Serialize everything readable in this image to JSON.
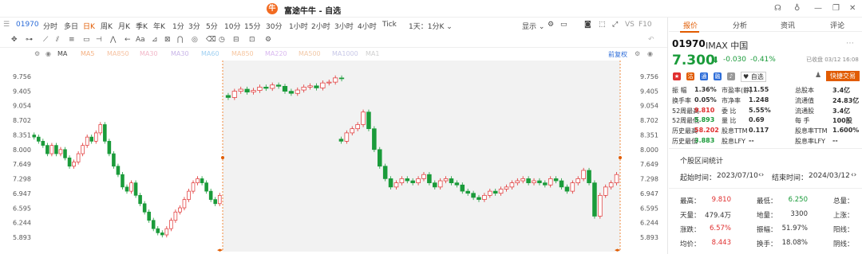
{
  "window": {
    "title": "富途牛牛 - 自选",
    "logo": "牛"
  },
  "toolbar": {
    "code": "01970",
    "periods": [
      "分时",
      "多日",
      "日K",
      "周K",
      "月K",
      "季K",
      "年K",
      "1分",
      "3分",
      "5分",
      "10分",
      "15分",
      "30分",
      "1小时",
      "2小时",
      "3小时",
      "4小时",
      "Tick"
    ],
    "active_period": "日K",
    "range": "1天：1分K ⌄",
    "display": "显示 ⌄",
    "vs": "VS",
    "f10": "F10"
  },
  "ma_row": {
    "label": "MA",
    "items": [
      "MA5",
      "MA850",
      "MA30",
      "MA30",
      "MA60",
      "MA850",
      "MA220",
      "MA500",
      "MA1000",
      "MA1"
    ],
    "restore": "前复权"
  },
  "chart_data": {
    "type": "candlestick",
    "y_ticks": [
      "9.756",
      "9.405",
      "9.054",
      "8.702",
      "8.351",
      "8.000",
      "7.649",
      "7.298",
      "6.947",
      "6.595",
      "6.244",
      "5.893"
    ],
    "y_range": [
      5.893,
      9.756
    ],
    "close": [
      8.3,
      8.2,
      8.1,
      7.9,
      8.1,
      7.9,
      8.0,
      7.8,
      7.6,
      7.7,
      7.9,
      8.1,
      8.3,
      8.2,
      8.4,
      8.6,
      8.2,
      7.9,
      7.6,
      7.4,
      7.1,
      7.0,
      7.2,
      6.9,
      6.7,
      6.5,
      6.3,
      6.1,
      6.0,
      5.95,
      6.1,
      6.3,
      6.5,
      6.6,
      6.8,
      7.0,
      7.2,
      7.3,
      7.2,
      7.0,
      6.8,
      6.7,
      6.9,
      9.25,
      9.4,
      9.45,
      9.38,
      9.42,
      9.5,
      9.47,
      9.55,
      9.52,
      9.4,
      9.35,
      9.43,
      9.5,
      9.53,
      9.48,
      9.6,
      9.62,
      9.72,
      9.7
    ],
    "close2": [
      8.2,
      8.4,
      8.5,
      8.6,
      8.9,
      8.5,
      8.0,
      7.6,
      7.3,
      7.1,
      7.2,
      7.3,
      7.25,
      7.2,
      7.3,
      7.4,
      7.2,
      7.1,
      7.25,
      7.3,
      7.2,
      7.15,
      7.0,
      6.95,
      6.85,
      6.8,
      6.9,
      7.0,
      6.95,
      7.05,
      7.1,
      7.2,
      7.25,
      7.3,
      7.2,
      7.25,
      7.2,
      7.15,
      7.3,
      7.25,
      7.1,
      7.0,
      7.2,
      7.3,
      7.5,
      7.2,
      6.4,
      6.9,
      7.1,
      7.2,
      7.4
    ]
  },
  "stock": {
    "code": "01970",
    "name": "IMAX 中国",
    "price": "7.300",
    "arrow": "⬇",
    "change": "-0.030",
    "pct": "-0.41%",
    "status": "已收盘 03/12 16:08",
    "quick_trade": "快捷交易",
    "self": "自选"
  },
  "rtabs": [
    "报价",
    "分析",
    "资讯",
    "评论"
  ],
  "info": [
    [
      "振    幅",
      "1.36%",
      "市盈率(静)",
      "11.55",
      "总股本",
      "3.4亿"
    ],
    [
      "换手率",
      "0.05%",
      "市净率",
      "1.248",
      "流通值",
      "24.83亿"
    ],
    [
      "52周最高",
      "9.810",
      "委    比",
      "5.55%",
      "流通股",
      "3.4亿"
    ],
    [
      "52周最低",
      "5.893",
      "量    比",
      "0.69",
      "每    手",
      "100股"
    ],
    [
      "历史最高",
      "58.202",
      "股息TTM",
      "0.117",
      "股息率TTM",
      "1.600%"
    ],
    [
      "历史最低",
      "3.883",
      "股息LFY",
      "--",
      "股息率LFY",
      "--"
    ]
  ],
  "range_stats": {
    "title": "个股区间统计",
    "start_label": "起始时间：",
    "start": "2023/07/10",
    "end_label": "结束时间：",
    "end": "2024/03/12"
  },
  "stats": [
    [
      "最高：",
      "9.810",
      "最低：",
      "6.250",
      "总量："
    ],
    [
      "天量：",
      "479.4万",
      "地量：",
      "3300",
      "上涨："
    ],
    [
      "涨跌：",
      "6.57%",
      "振幅：",
      "51.97%",
      "阳线："
    ],
    [
      "均价：",
      "8.443",
      "换手：",
      "18.08%",
      "阴线："
    ]
  ],
  "colors": {
    "accent": "#e15b00",
    "up": "#e02f2f",
    "down": "#1a9b3a"
  }
}
